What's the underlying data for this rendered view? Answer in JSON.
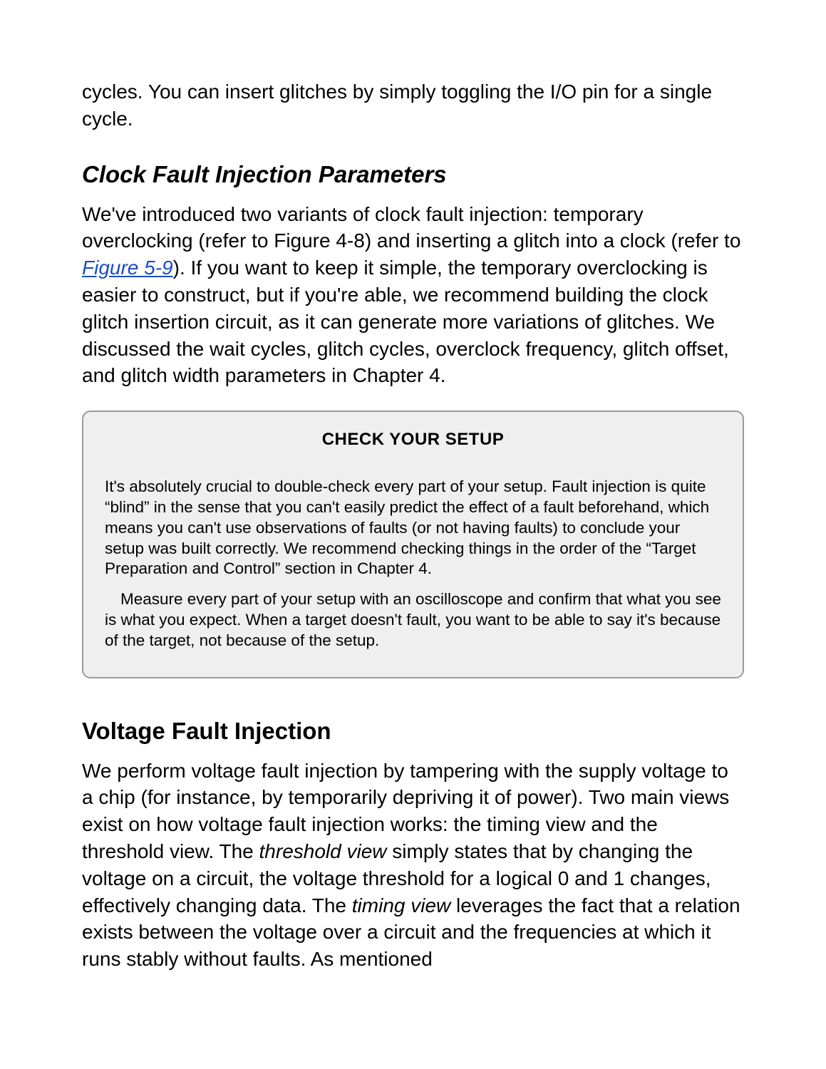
{
  "intro_fragment": "cycles. You can insert glitches by simply toggling the I/O pin for a single cycle.",
  "section1": {
    "title": "Clock Fault Injection Parameters",
    "para_pre": "We've introduced two variants of clock fault injection: temporary overclocking (refer to Figure 4-8) and inserting a glitch into a clock (refer to ",
    "figure_link": "Figure 5-9",
    "para_post": "). If you want to keep it simple, the temporary overclocking is easier to construct, but if you're able, we recommend building the clock glitch insertion circuit, as it can generate more variations of glitches. We discussed the wait cycles, glitch cycles, overclock frequency, glitch offset, and glitch width parameters in Chapter 4."
  },
  "callout": {
    "title": "CHECK YOUR SETUP",
    "p1": "It's absolutely crucial to double-check every part of your setup. Fault injection is quite “blind” in the sense that you can't easily predict the effect of a fault beforehand, which means you can't use observations of faults (or not having faults) to conclude your setup was built correctly. We recommend checking things in the order of the “Target Preparation and Control” section in Chapter 4.",
    "p2": "Measure every part of your setup with an oscilloscope and confirm that what you see is what you expect. When a target doesn't fault, you want to be able to say it's because of the target, not because of the setup."
  },
  "section2": {
    "title": "Voltage Fault Injection",
    "p_a": "We perform voltage fault injection by tampering with the supply voltage to a chip (for instance, by temporarily depriving it of power). Two main views exist on how voltage fault injection works: the timing view and the threshold view. The ",
    "em1": "threshold view",
    "p_b": " simply states that by changing the voltage on a circuit, the voltage threshold for a logical 0 and 1 changes, effectively changing data. The ",
    "em2": "timing view",
    "p_c": " leverages the fact that a relation exists between the voltage over a circuit and the frequencies at which it runs stably without faults. As mentioned"
  }
}
